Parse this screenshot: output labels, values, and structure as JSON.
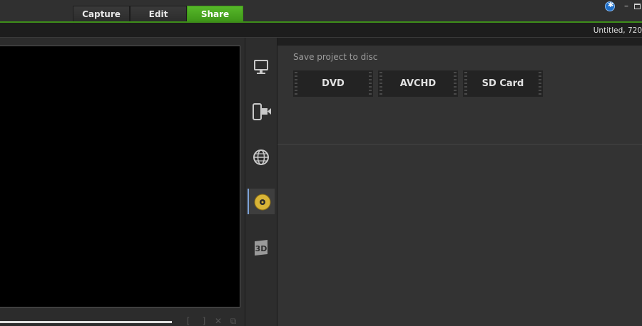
{
  "tabs": [
    {
      "label": "Capture",
      "active": false
    },
    {
      "label": "Edit",
      "active": false
    },
    {
      "label": "Share",
      "active": true
    }
  ],
  "project_title": "Untitled, 720",
  "disc_section": {
    "label": "Save project to disc",
    "options": [
      "DVD",
      "AVCHD",
      "SD Card"
    ]
  },
  "side_nav": [
    "monitor-icon",
    "mobile-device-icon",
    "globe-icon",
    "disc-icon",
    "3d-icon"
  ],
  "selected_nav": "disc-icon",
  "colors": {
    "accent": "#4aac22",
    "selected_nav_border": "#7fa4d9",
    "background": "#242424"
  }
}
